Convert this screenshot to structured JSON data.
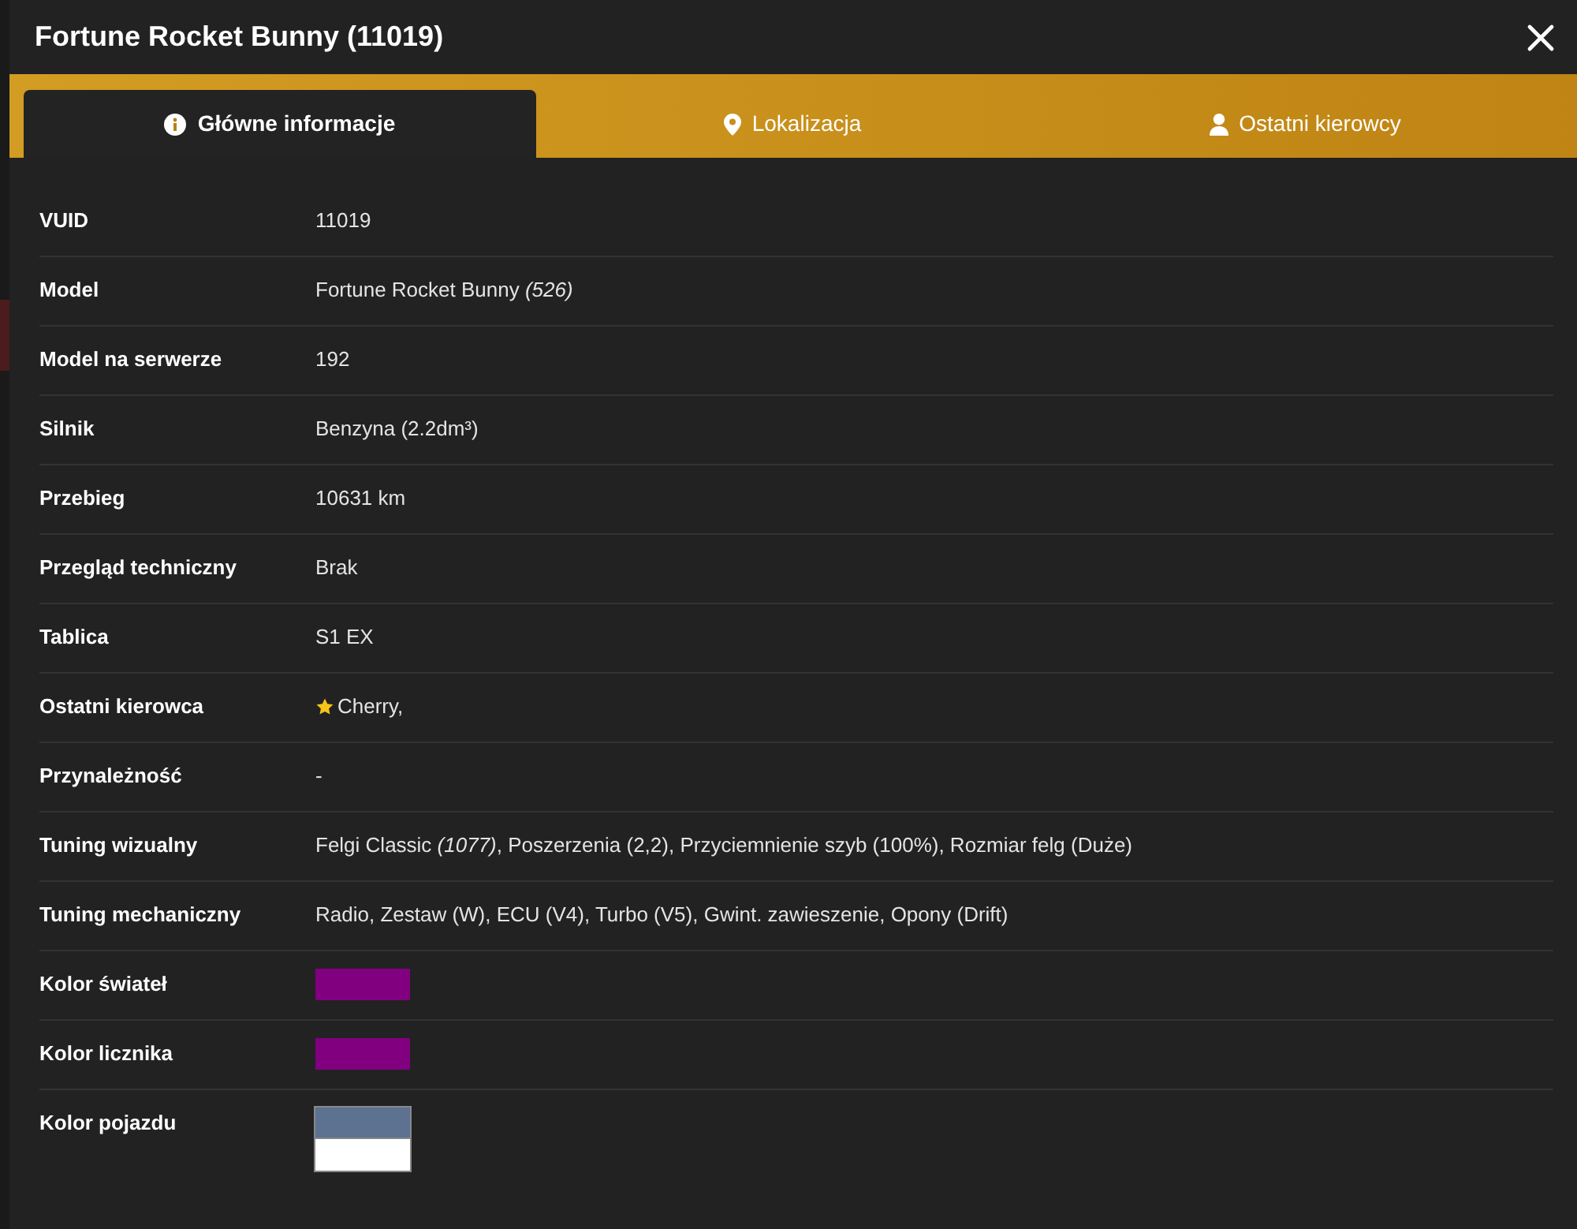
{
  "window": {
    "title": "Fortune Rocket Bunny (11019)"
  },
  "tabs": [
    {
      "label": "Główne informacje",
      "selected": true
    },
    {
      "label": "Lokalizacja",
      "selected": false
    },
    {
      "label": "Ostatni kierowcy",
      "selected": false
    }
  ],
  "rows": [
    {
      "kind": "text",
      "label": "VUID",
      "value": "11019"
    },
    {
      "kind": "text",
      "label": "Model",
      "value": "Fortune Rocket Bunny *(526)*"
    },
    {
      "kind": "text",
      "label": "Model na serwerze",
      "value": "192"
    },
    {
      "kind": "text",
      "label": "Silnik",
      "value": "Benzyna (2.2dm³)"
    },
    {
      "kind": "text",
      "label": "Przebieg",
      "value": "10631 km"
    },
    {
      "kind": "text",
      "label": "Przegląd techniczny",
      "value": "Brak"
    },
    {
      "kind": "text",
      "label": "Tablica",
      "value": "S1 EX"
    },
    {
      "kind": "driver",
      "label": "Ostatni kierowca",
      "value": "Cherry,"
    },
    {
      "kind": "text",
      "label": "Przynależność",
      "value": "-"
    },
    {
      "kind": "text",
      "label": "Tuning wizualny",
      "value": "Felgi Classic *(1077)*, Poszerzenia (2,2), Przyciemnienie szyb (100%), Rozmiar felg (Duże)"
    },
    {
      "kind": "text",
      "label": "Tuning mechaniczny",
      "value": "Radio, Zestaw (W), ECU (V4), Turbo (V5), Gwint. zawieszenie, Opony (Drift)"
    },
    {
      "kind": "color",
      "label": "Kolor świateł",
      "colors": [
        {
          "color": "#800080"
        }
      ]
    },
    {
      "kind": "color",
      "label": "Kolor licznika",
      "colors": [
        {
          "color": "#800080"
        }
      ]
    },
    {
      "kind": "color",
      "label": "Kolor pojazdu",
      "colors": [
        {
          "color": "#5c7290"
        },
        {
          "color": "#ffffff"
        }
      ]
    }
  ]
}
